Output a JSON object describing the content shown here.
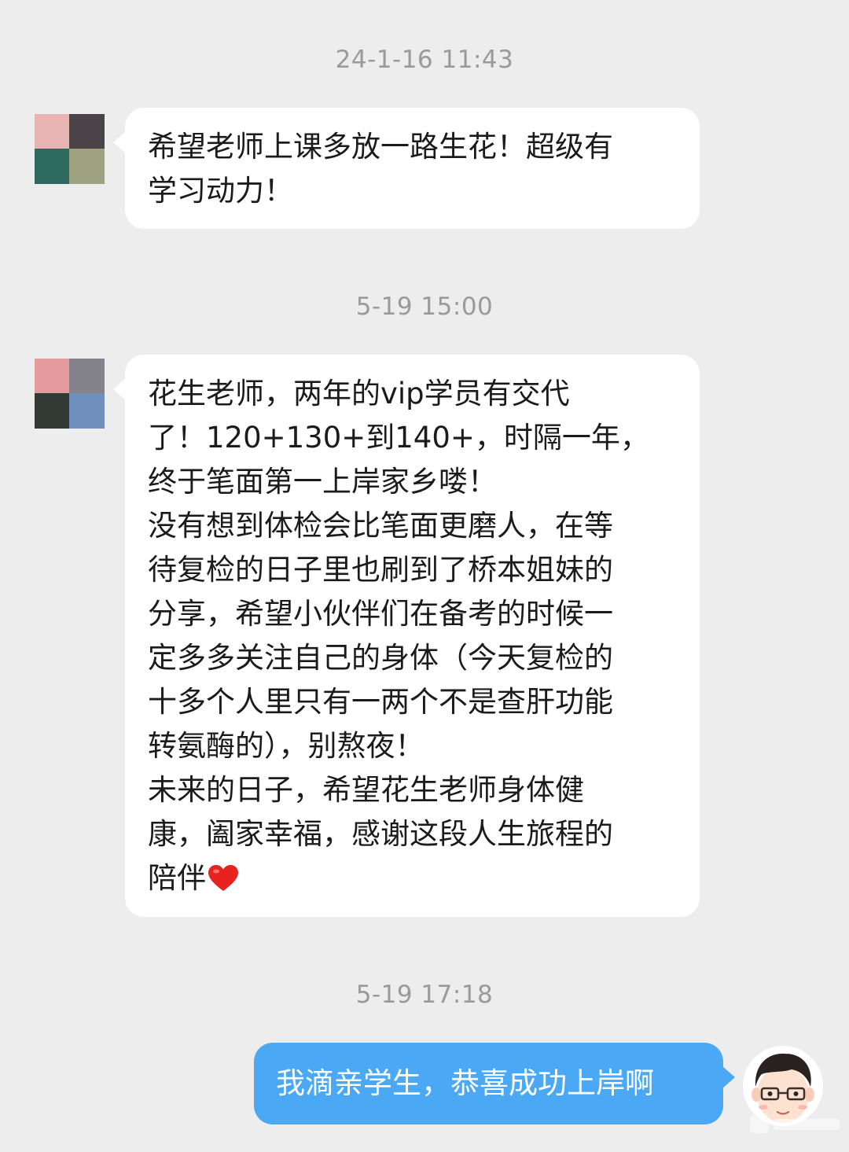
{
  "conversation": {
    "timestamps": [
      "24-1-16 11:43",
      "5-19 15:00",
      "5-19 17:18"
    ],
    "messages": [
      {
        "sender": "other",
        "avatar_colors": [
          "#e8b4b4",
          "#4a4448",
          "#2e6a60",
          "#9ea283"
        ],
        "lines": [
          "希望老师上课多放一路生花！超级有",
          "学习动力！"
        ]
      },
      {
        "sender": "other",
        "avatar_colors": [
          "#e39a9c",
          "#84828a",
          "#333a33",
          "#6f90bd"
        ],
        "lines": [
          "花生老师，两年的vip学员有交代",
          "了！120+130+到140+，时隔一年，",
          "终于笔面第一上岸家乡喽！",
          "没有想到体检会比笔面更磨人，在等",
          "待复检的日子里也刷到了桥本姐妹的",
          "分享，希望小伙伴们在备考的时候一",
          "定多多关注自己的身体（今天复检的",
          "十多个人里只有一两个不是查肝功能",
          "转氨酶的），别熬夜！",
          "未来的日子，希望花生老师身体健",
          "康，阖家幸福，感谢这段人生旅程的",
          "陪伴"
        ],
        "trailing_icon": "red-heart-emoji"
      },
      {
        "sender": "me",
        "text": "我滴亲学生，恭喜成功上岸啊",
        "avatar_icon": "cartoon-man-with-glasses"
      }
    ]
  },
  "colors": {
    "background": "#ededed",
    "incoming_bubble": "#ffffff",
    "outgoing_bubble": "#4aa8f4",
    "timestamp_text": "#9a9a9a",
    "message_text": "#1b1b1b"
  }
}
